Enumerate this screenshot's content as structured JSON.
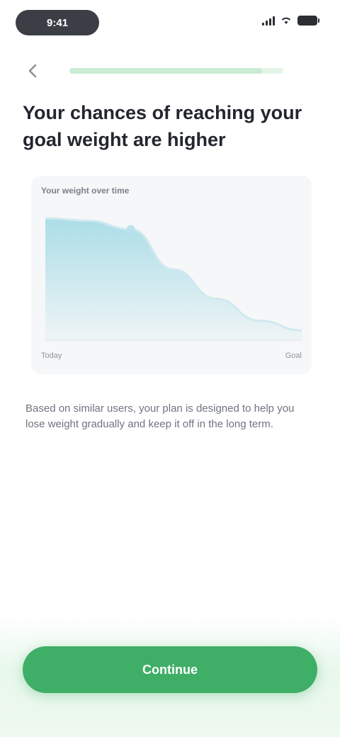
{
  "status_bar": {
    "time": "9:41",
    "icons": [
      "signal-icon",
      "wifi-icon",
      "battery-icon"
    ]
  },
  "header": {
    "back_icon": "chevron-left-icon",
    "progress_fraction": 0.9
  },
  "question": {
    "title": "Your chances of reaching your goal weight are higher"
  },
  "chart_data": {
    "type": "area",
    "title": "Your weight over time",
    "x": [
      "Today",
      "",
      "",
      "",
      "",
      "",
      "Goal"
    ],
    "values": [
      10,
      9.8,
      9.1,
      5.8,
      3.4,
      1.6,
      0.8
    ],
    "x_start_label": "Today",
    "x_end_label": "Goal",
    "grid": false,
    "legend": "none",
    "fill_color": "#a8dce7",
    "line_color": "#cfe9ef"
  },
  "explanation": {
    "text": "Based on similar users, your plan is designed to help you lose weight gradually and keep it off in the long term."
  },
  "cta": {
    "label": "Continue"
  },
  "colors": {
    "accent": "#3fae67",
    "progress_track": "#e4f5e8"
  }
}
